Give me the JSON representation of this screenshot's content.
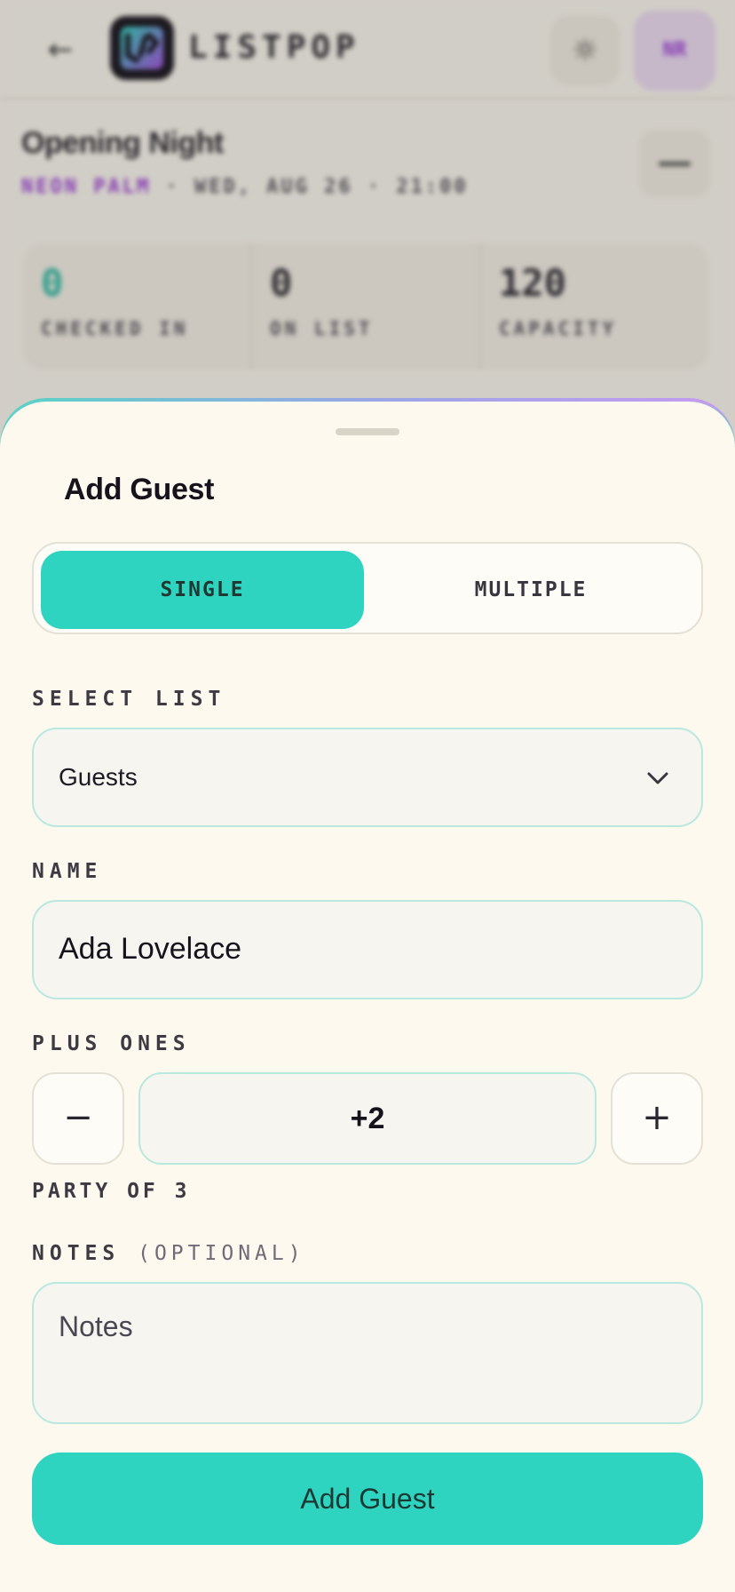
{
  "app": {
    "brand": "LISTPOP",
    "avatar_initials": "NR",
    "back_icon": "arrow-left-icon",
    "theme_icon": "sun-icon"
  },
  "event": {
    "title": "Opening Night",
    "venue": "NEON PALM",
    "datetime": "· WED, AUG 26 · 21:00"
  },
  "stats": [
    {
      "value": "0",
      "label": "CHECKED IN"
    },
    {
      "value": "0",
      "label": "ON LIST"
    },
    {
      "value": "120",
      "label": "CAPACITY"
    }
  ],
  "sheet": {
    "title": "Add Guest",
    "modes": {
      "single": "SINGLE",
      "multiple": "MULTIPLE",
      "selected": "single"
    },
    "select_list": {
      "label": "SELECT LIST",
      "value": "Guests"
    },
    "name": {
      "label": "NAME",
      "value": "Ada Lovelace"
    },
    "plus_ones": {
      "label": "PLUS ONES",
      "value": "+2",
      "party_text": "PARTY OF 3",
      "minus": "−",
      "plus": "+"
    },
    "notes": {
      "label": "NOTES",
      "optional": "(OPTIONAL)",
      "placeholder": "Notes"
    },
    "submit_label": "Add Guest"
  },
  "colors": {
    "accent": "#2fd4c0",
    "venue": "#9b3ed8",
    "background": "#fdf9ef"
  }
}
